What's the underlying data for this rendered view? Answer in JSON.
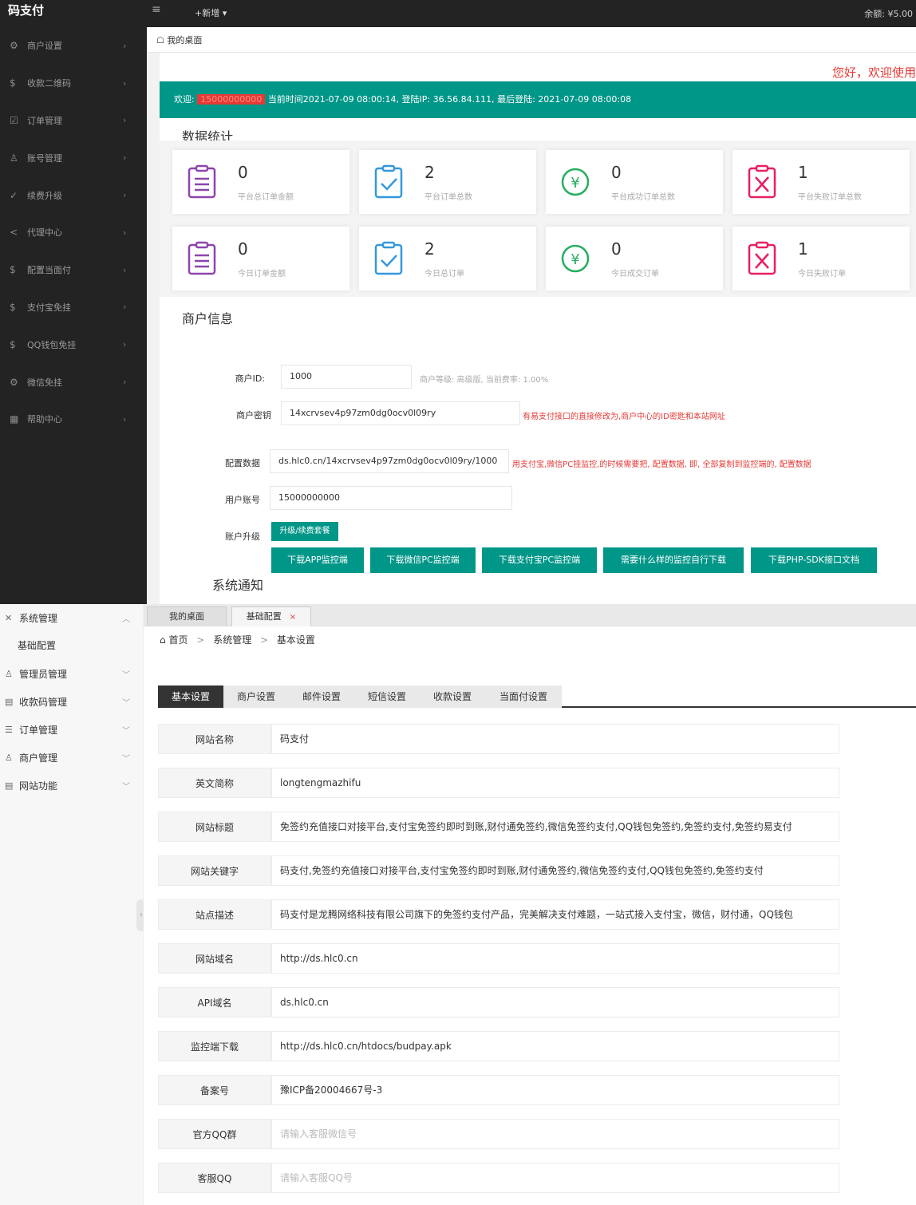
{
  "top": {
    "logo": "码支付",
    "menu_icon": "≡",
    "add_label": "+新增 ▾",
    "balance": "余额: ¥5.00",
    "breadcrumb_tab": "我的桌面",
    "sidebar": [
      {
        "icon": "gear-icon",
        "glyph": "⚙",
        "label": "商户设置"
      },
      {
        "icon": "qr-icon",
        "glyph": "$",
        "label": "收款二维码"
      },
      {
        "icon": "order-icon",
        "glyph": "☑",
        "label": "订单管理"
      },
      {
        "icon": "user-icon",
        "glyph": "♙",
        "label": "账号管理"
      },
      {
        "icon": "upgrade-icon",
        "glyph": "✓",
        "label": "续费升级"
      },
      {
        "icon": "share-icon",
        "glyph": "<",
        "label": "代理中心"
      },
      {
        "icon": "pay-icon",
        "glyph": "$",
        "label": "配置当面付"
      },
      {
        "icon": "alipay-icon",
        "glyph": "$",
        "label": "支付宝免挂"
      },
      {
        "icon": "qq-icon",
        "glyph": "$",
        "label": "QQ钱包免挂"
      },
      {
        "icon": "wechat-icon",
        "glyph": "⚙",
        "label": "微信免挂"
      },
      {
        "icon": "help-icon",
        "glyph": "▦",
        "label": "帮助中心"
      }
    ],
    "greeting": "您好，欢迎使用",
    "banner": {
      "prefix": "欢迎:",
      "account": "15000000000",
      "info": "当前时间2021-07-09 08:00:14, 登陆IP: 36.56.84.111, 最后登陆: 2021-07-09 08:00:08"
    },
    "stats_title": "数据统计",
    "stats": [
      {
        "value": "0",
        "label": "平台总订单金额",
        "icon": "list-icon",
        "color": "#8e44ad"
      },
      {
        "value": "2",
        "label": "平台订单总数",
        "icon": "check-icon",
        "color": "#3498db"
      },
      {
        "value": "0",
        "label": "平台成功订单总数",
        "icon": "yen-icon",
        "color": "#27ae60"
      },
      {
        "value": "1",
        "label": "平台失败订单总数",
        "icon": "fail-icon",
        "color": "#e91e63"
      },
      {
        "value": "0",
        "label": "今日订单金额",
        "icon": "list-icon",
        "color": "#8e44ad"
      },
      {
        "value": "2",
        "label": "今日总订单",
        "icon": "check-icon",
        "color": "#3498db"
      },
      {
        "value": "0",
        "label": "今日成交订单",
        "icon": "yen-icon",
        "color": "#27ae60"
      },
      {
        "value": "1",
        "label": "今日失败订单",
        "icon": "fail-icon",
        "color": "#e91e63"
      }
    ],
    "merchant_title": "商户信息",
    "merchant": {
      "id_label": "商户ID:",
      "id_value": "1000",
      "level_note": "商户等级: 高级版, 当前费率: 1.00%",
      "key_label": "商户密钥",
      "key_value": "14xcrvsev4p97zm0dg0ocv0l09ry",
      "key_note": "有易支付接口的直接修改为,商户中心的ID密匙和本站网址",
      "config_label": "配置数据",
      "config_value": "ds.hlc0.cn/14xcrvsev4p97zm0dg0ocv0l09ry/1000",
      "config_note": "用支付宝,微信PC挂监控,的时候需要把, 配置数据, 即, 全部复制到监控端的, 配置数据",
      "account_label": "用户账号",
      "account_value": "15000000000",
      "upgrade_label": "账户升级",
      "upgrade_btn": "升级/续费套餐"
    },
    "download_buttons": [
      "下载APP监控端",
      "下载微信PC监控端",
      "下载支付宝PC监控端",
      "需要什么样的监控自行下载",
      "下载PHP-SDK接口文档"
    ],
    "notice_title": "系统通知"
  },
  "bottom": {
    "sidebar": [
      {
        "icon": "tools-icon",
        "glyph": "✕",
        "label": "系统管理",
        "arrow": "︿"
      },
      {
        "sub": "基础配置"
      },
      {
        "icon": "admin-icon",
        "glyph": "♙",
        "label": "管理员管理",
        "arrow": "﹀"
      },
      {
        "icon": "qrcode-icon",
        "glyph": "▤",
        "label": "收款码管理",
        "arrow": "﹀"
      },
      {
        "icon": "order-list-icon",
        "glyph": "☰",
        "label": "订单管理",
        "arrow": "﹀"
      },
      {
        "icon": "merchant-icon",
        "glyph": "♙",
        "label": "商户管理",
        "arrow": "﹀"
      },
      {
        "icon": "site-icon",
        "glyph": "▤",
        "label": "网站功能",
        "arrow": "﹀"
      }
    ],
    "tabs": [
      {
        "label": "我的桌面"
      },
      {
        "label": "基础配置",
        "close": "×"
      }
    ],
    "breadcrumb": {
      "home": "首页",
      "sep": ">",
      "level1": "系统管理",
      "level2": "基本设置"
    },
    "subtabs": [
      "基本设置",
      "商户设置",
      "邮件设置",
      "短信设置",
      "收款设置",
      "当面付设置"
    ],
    "fields": [
      {
        "label": "网站名称",
        "value": "码支付"
      },
      {
        "label": "英文简称",
        "value": "longtengmazhifu"
      },
      {
        "label": "网站标题",
        "value": "免签约充值接口对接平台,支付宝免签约即时到账,财付通免签约,微信免签约支付,QQ钱包免签约,免签约支付,免签约易支付"
      },
      {
        "label": "网站关键字",
        "value": "码支付,免签约充值接口对接平台,支付宝免签约即时到账,财付通免签约,微信免签约支付,QQ钱包免签约,免签约支付"
      },
      {
        "label": "站点描述",
        "value": "码支付是龙腾网络科技有限公司旗下的免签约支付产品，完美解决支付难题，一站式接入支付宝，微信，财付通，QQ钱包"
      },
      {
        "label": "网站域名",
        "value": "http://ds.hlc0.cn"
      },
      {
        "label": "API域名",
        "value": "ds.hlc0.cn"
      },
      {
        "label": "监控端下载",
        "value": "http://ds.hlc0.cn/htdocs/budpay.apk"
      },
      {
        "label": "备案号",
        "value": "豫ICP备20004667号-3"
      },
      {
        "label": "官方QQ群",
        "value": "",
        "placeholder": "请输入客服微信号"
      },
      {
        "label": "客服QQ",
        "value": "",
        "placeholder": "请输入客服QQ号"
      }
    ]
  }
}
